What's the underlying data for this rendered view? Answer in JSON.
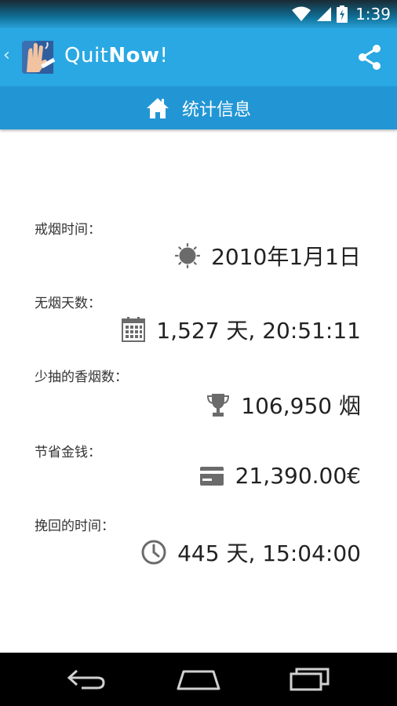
{
  "status_bar": {
    "time": "1:39",
    "icons": [
      "wifi-icon",
      "signal-icon",
      "battery-charging-icon"
    ]
  },
  "action_bar": {
    "back_glyph": "‹",
    "title_light": "Quit",
    "title_bold": "Now",
    "title_end": "!",
    "icons": [
      "app-logo-icon",
      "share-icon"
    ]
  },
  "section": {
    "title": "统计信息",
    "icon": "home-icon"
  },
  "stats": [
    {
      "label": "戒烟时间：",
      "value": "2010年1月1日",
      "icon": "sun-icon"
    },
    {
      "label": "无烟天数：",
      "value": "1,527 天, 20:51:11",
      "icon": "calendar-icon"
    },
    {
      "label": "少抽的香烟数：",
      "value": "106,950 烟",
      "icon": "trophy-icon"
    },
    {
      "label": "节省金钱：",
      "value": "21,390.00€",
      "icon": "credit-card-icon"
    },
    {
      "label": "挽回的时间：",
      "value": "445 天, 15:04:00",
      "icon": "clock-icon"
    }
  ],
  "nav_bar": {
    "icons": [
      "back-icon",
      "home-icon",
      "recents-icon"
    ]
  },
  "colors": {
    "action_bar": "#29a8e3",
    "section_header": "#2296d5",
    "icon_gray": "#6b6b6b"
  }
}
